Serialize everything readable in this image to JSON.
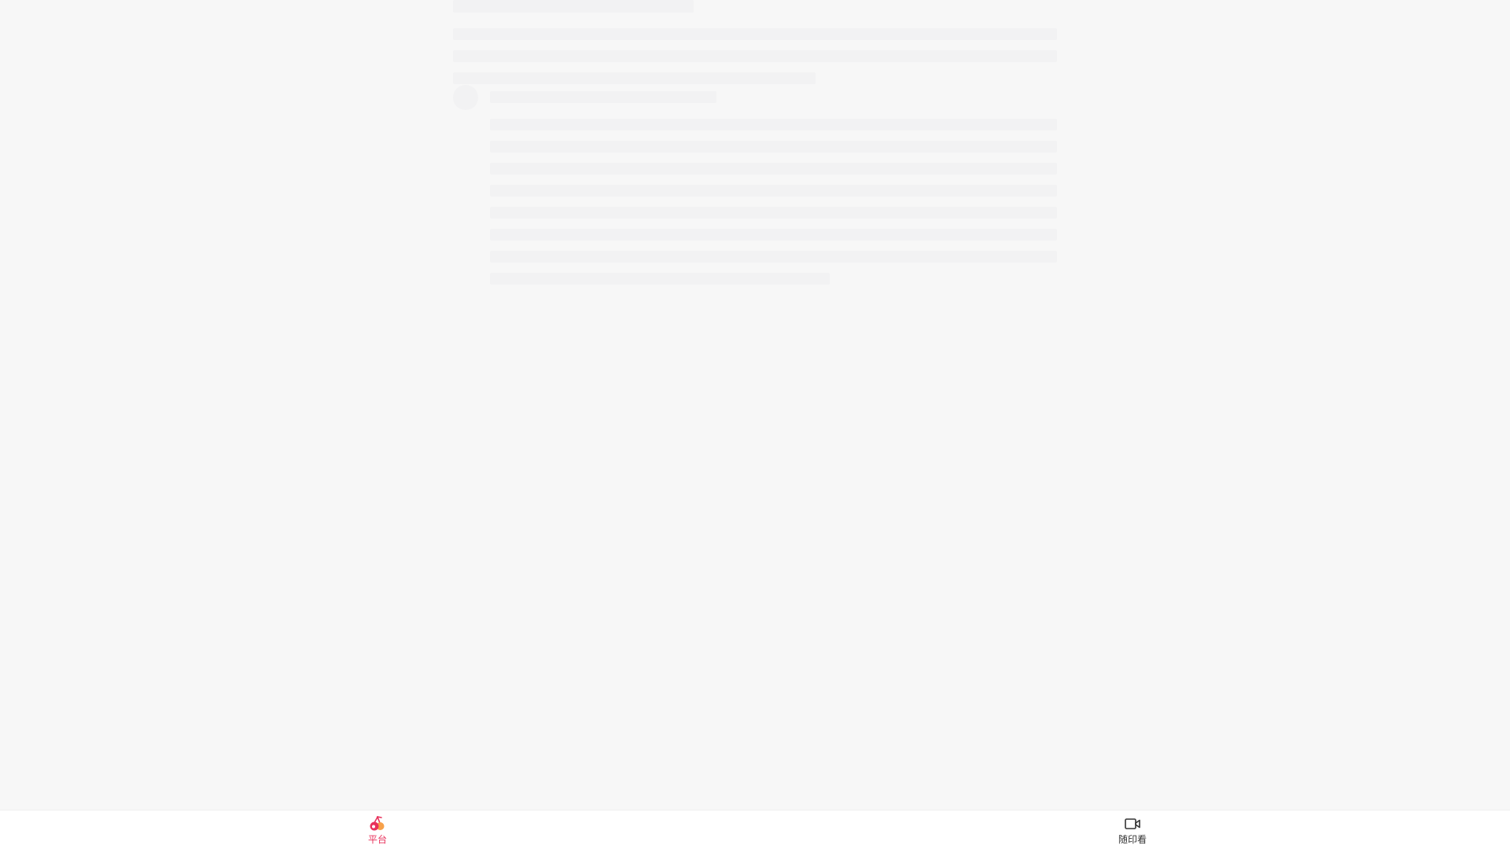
{
  "tabbar": {
    "tabs": [
      {
        "label": "平台",
        "icon": "cherry-icon",
        "active": true,
        "color": "#e8315b"
      },
      {
        "label": "随印看",
        "icon": "video-camera-icon",
        "active": false,
        "color": "#333333"
      }
    ]
  },
  "colors": {
    "background": "#f7f7f7",
    "skeleton": "#f2f2f3",
    "accent": "#e8315b",
    "accent_secondary": "#f7a14a"
  }
}
